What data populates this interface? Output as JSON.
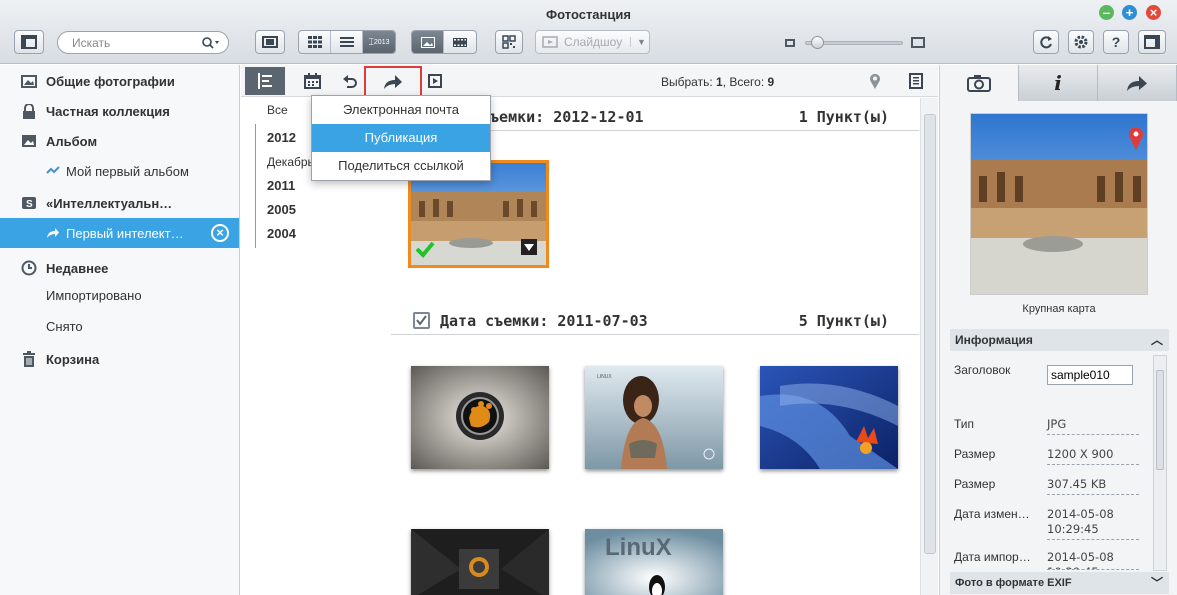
{
  "window": {
    "title": "Фотостанция"
  },
  "toolbar": {
    "search_placeholder": "Искать",
    "slideshow_label": "Слайдшоу",
    "view_date_badge": "2013"
  },
  "sidebar": {
    "items": [
      {
        "label": "Общие фотографии"
      },
      {
        "label": "Частная коллекция"
      },
      {
        "label": "Альбом"
      },
      {
        "label": "Мой первый альбом"
      },
      {
        "label": "«Интеллектуальн…"
      },
      {
        "label": "Первый интелект…"
      },
      {
        "label": "Недавнее"
      },
      {
        "label": "Импортировано"
      },
      {
        "label": "Снято"
      },
      {
        "label": "Корзина"
      }
    ]
  },
  "content_toolbar": {
    "select_label": "Выбрать:",
    "select_value": "1",
    "total_label": "Всего:",
    "total_value": "9"
  },
  "timeline": {
    "all": "Все",
    "y2012": "2012",
    "december": "Декабрь",
    "y2011": "2011",
    "y2005": "2005",
    "y2004": "2004"
  },
  "share_menu": {
    "items": [
      "Электронная почта",
      "Публикация",
      "Поделиться ссылкой"
    ],
    "selected": "Публикация"
  },
  "sections": [
    {
      "title_visible": "съемки: 2012-12-01",
      "count": "1 Пункт(ы)"
    },
    {
      "title": "Дата съемки: 2011-07-03",
      "count": "5 Пункт(ы)"
    }
  ],
  "right_panel": {
    "map_label": "Крупная карта",
    "info_title": "Информация",
    "title_label": "Заголовок",
    "title_value": "sample010",
    "rows": [
      {
        "k": "Тип",
        "v": "JPG"
      },
      {
        "k": "Размер",
        "v": "1200 X 900"
      },
      {
        "k": "Размер",
        "v": "307.45 KB"
      },
      {
        "k": "Дата измен…",
        "v": "2014-05-08 10:29:45"
      },
      {
        "k": "Дата импор…",
        "v": "2014-05-08 10:29:45"
      }
    ],
    "exif_title": "Фото в формате EXIF"
  },
  "colors": {
    "accent": "#3aa3e3",
    "selection_border": "#f08a1c",
    "highlight_red": "#e03b3b"
  }
}
